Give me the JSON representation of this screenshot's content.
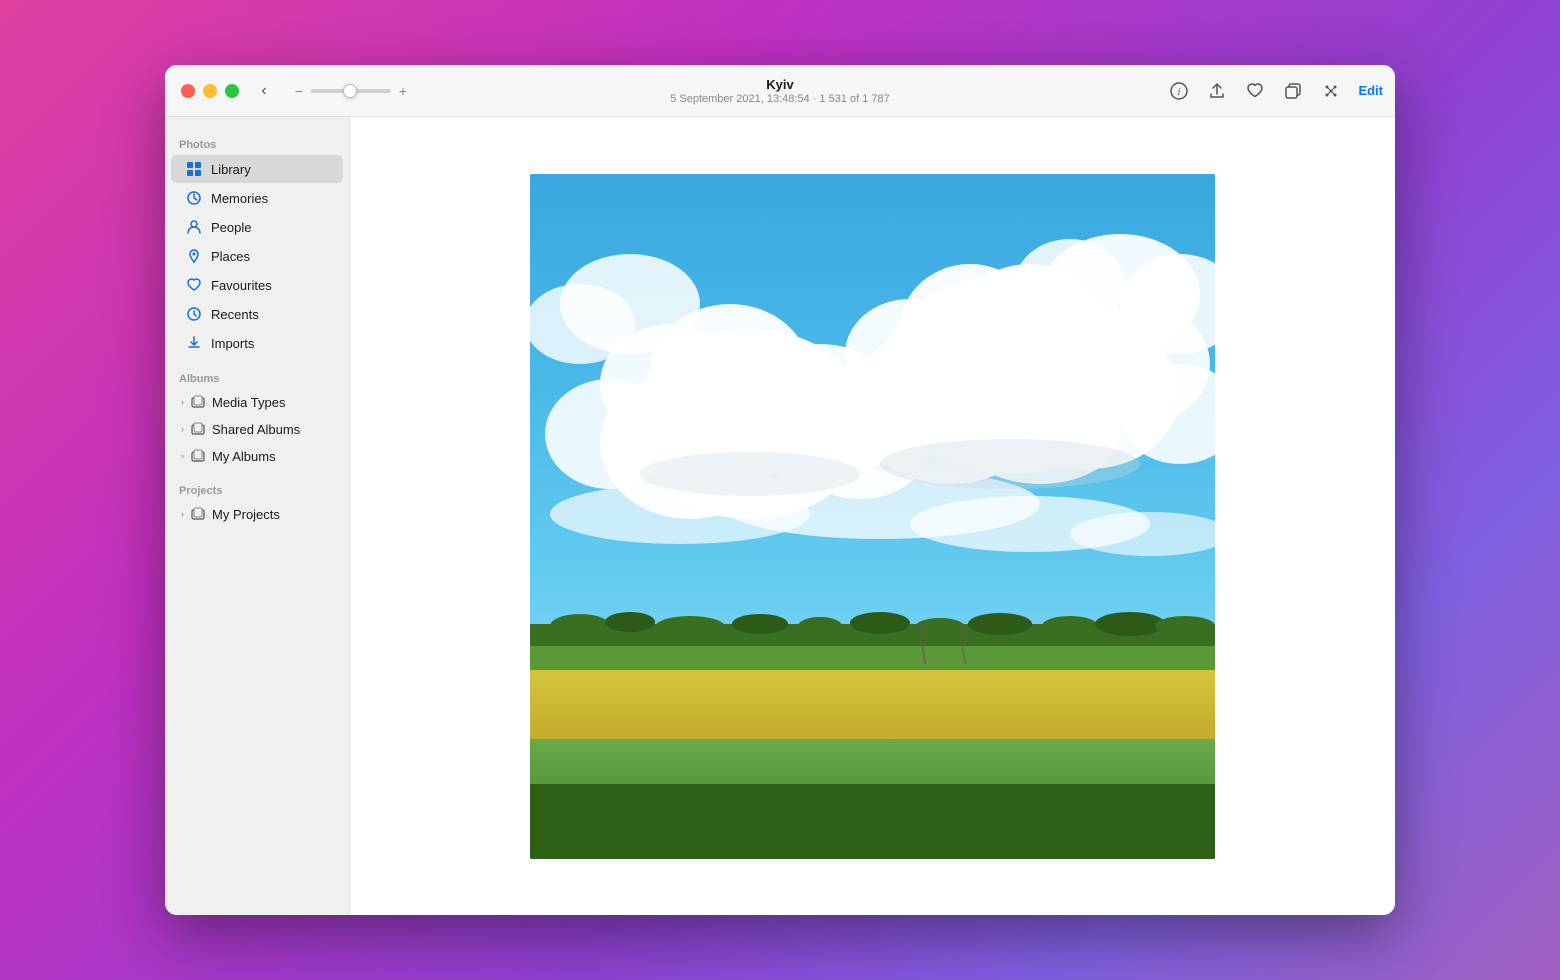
{
  "window": {
    "title": "Kyiv",
    "subtitle": "5 September 2021, 13:48:54  ·  1 531 of 1 787"
  },
  "controls": {
    "back_label": "‹",
    "zoom_minus": "−",
    "zoom_plus": "+",
    "edit_label": "Edit"
  },
  "sidebar": {
    "photos_section": "Photos",
    "albums_section": "Albums",
    "projects_section": "Projects",
    "items": [
      {
        "id": "library",
        "label": "Library",
        "icon": "grid",
        "active": true
      },
      {
        "id": "memories",
        "label": "Memories",
        "icon": "spiral",
        "active": false
      },
      {
        "id": "people",
        "label": "People",
        "icon": "person",
        "active": false
      },
      {
        "id": "places",
        "label": "Places",
        "icon": "pin",
        "active": false
      },
      {
        "id": "favourites",
        "label": "Favourites",
        "icon": "heart",
        "active": false
      },
      {
        "id": "recents",
        "label": "Recents",
        "icon": "clock",
        "active": false
      },
      {
        "id": "imports",
        "label": "Imports",
        "icon": "import",
        "active": false
      }
    ],
    "album_items": [
      {
        "id": "media-types",
        "label": "Media Types",
        "icon": "folder"
      },
      {
        "id": "shared-albums",
        "label": "Shared Albums",
        "icon": "folder"
      },
      {
        "id": "my-albums",
        "label": "My Albums",
        "icon": "folder"
      }
    ],
    "project_items": [
      {
        "id": "my-projects",
        "label": "My Projects",
        "icon": "folder"
      }
    ]
  },
  "toolbar": {
    "info_icon": "ℹ",
    "share_icon": "⬆",
    "heart_icon": "♡",
    "copy_icon": "⧉",
    "magic_icon": "✦",
    "edit_label": "Edit"
  }
}
